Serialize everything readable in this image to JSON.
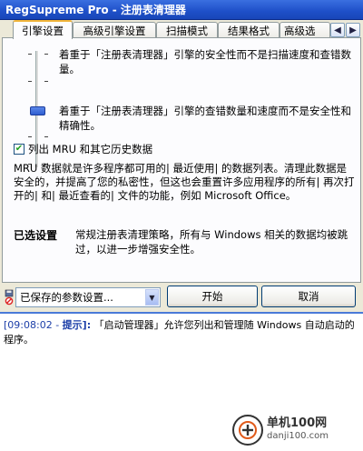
{
  "window": {
    "title": "RegSupreme Pro - 注册表清理器"
  },
  "tabs": [
    {
      "label": "引擎设置",
      "active": true
    },
    {
      "label": "高级引擎设置"
    },
    {
      "label": "扫描模式"
    },
    {
      "label": "结果格式"
    },
    {
      "label": "高级选"
    }
  ],
  "slider": {
    "top_description": "着重于「注册表清理器」引擎的安全性而不是扫描速度和查错数量。",
    "bottom_description": "着重于「注册表清理器」引擎的查错数量和速度而不是安全性和精确性。"
  },
  "mru": {
    "checkbox_label": "列出 MRU 和其它历史数据",
    "checked": true,
    "description": "MRU 数据就是许多程序都可用的| 最近使用| 的数据列表。清理此数据是安全的，并提高了您的私密性，但这也会重置许多应用程序的所有| 再次打开的| 和| 最近查看的| 文件的功能，例如 Microsoft Office。"
  },
  "preset": {
    "label": "已选设置",
    "description": "常规注册表清理策略，所有与 Windows 相关的数据均被跳过，以进一步增强安全性。"
  },
  "bottom": {
    "select_value": "已保存的参数设置...",
    "start_label": "开始",
    "cancel_label": "取消"
  },
  "log": {
    "time": "[09:08:02 -",
    "tag": "提示]:",
    "message": "「启动管理器」允许您列出和管理随 Windows 自动启动的程序。"
  },
  "watermark": {
    "line1": "单机100网",
    "line2": "danji100.com"
  },
  "colors": {
    "title_bar": "#1e4fc8",
    "tab_highlight": "#f1b43a",
    "log_accent": "#1d3fa8"
  }
}
